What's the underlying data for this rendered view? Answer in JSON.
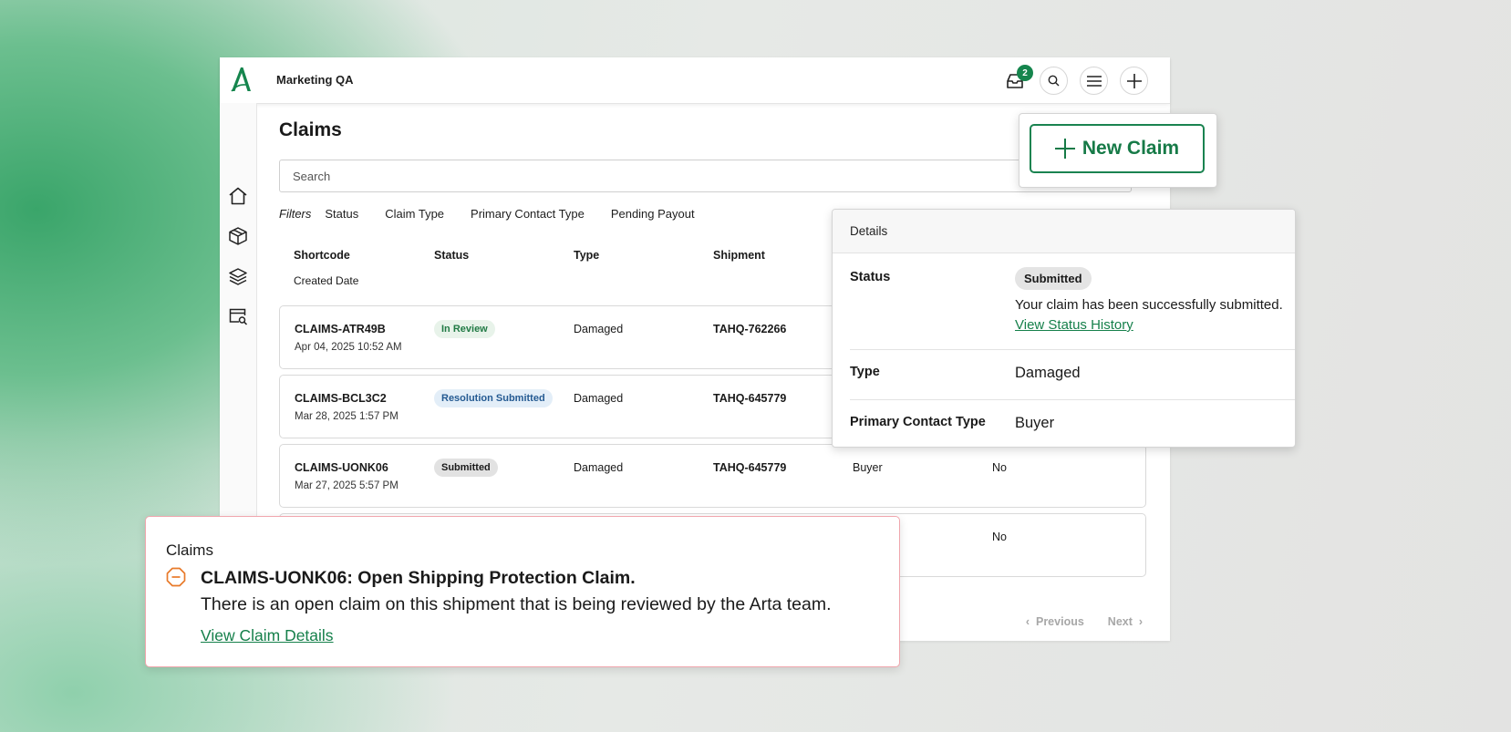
{
  "colors": {
    "brand_green": "#15854d",
    "pending_orange": "#e87a2a",
    "alert_border": "#f0a6ad"
  },
  "topbar": {
    "org_name": "Marketing QA",
    "inbox_count": "2",
    "icons": [
      "inbox-icon",
      "search-icon",
      "menu-icon",
      "plus-icon"
    ]
  },
  "sidebar": {
    "icons": [
      "home-icon",
      "package-icon",
      "layers-icon",
      "claims-search-icon"
    ]
  },
  "page": {
    "title": "Claims"
  },
  "search": {
    "placeholder": "Search"
  },
  "filters": {
    "label": "Filters",
    "items": [
      "Status",
      "Claim Type",
      "Primary Contact Type",
      "Pending Payout"
    ]
  },
  "table": {
    "headers": {
      "shortcode": "Shortcode",
      "status": "Status",
      "type": "Type",
      "shipment": "Shipment",
      "created_date": "Created Date"
    },
    "rows": [
      {
        "code": "CLAIMS-ATR49B",
        "date": "Apr 04, 2025 10:52 AM",
        "status": "In Review",
        "type": "Damaged",
        "shipment": "TAHQ-762266",
        "contact": "",
        "payout": ""
      },
      {
        "code": "CLAIMS-BCL3C2",
        "date": "Mar 28, 2025 1:57 PM",
        "status": "Resolution Submitted",
        "type": "Damaged",
        "shipment": "TAHQ-645779",
        "contact": "",
        "payout": ""
      },
      {
        "code": "CLAIMS-UONK06",
        "date": "Mar 27, 2025 5:57 PM",
        "status": "Submitted",
        "type": "Damaged",
        "shipment": "TAHQ-645779",
        "contact": "Buyer",
        "payout": "No"
      },
      {
        "code": "",
        "date": "",
        "status": "",
        "type": "",
        "shipment": "",
        "contact": "",
        "payout": "No"
      }
    ]
  },
  "pagination": {
    "previous": "Previous",
    "next": "Next"
  },
  "new_claim": {
    "label": "New Claim"
  },
  "details": {
    "title": "Details",
    "status_label": "Status",
    "status_value": "Submitted",
    "status_message": "Your claim has been successfully submitted.",
    "status_history_link": "View Status History",
    "type_label": "Type",
    "type_value": "Damaged",
    "contact_label": "Primary Contact Type",
    "contact_value": "Buyer"
  },
  "alert": {
    "label": "Claims",
    "title": "CLAIMS-UONK06: Open Shipping Protection Claim.",
    "body": "There is an open claim on this shipment that is being reviewed by the Arta team.",
    "link": "View Claim Details"
  }
}
